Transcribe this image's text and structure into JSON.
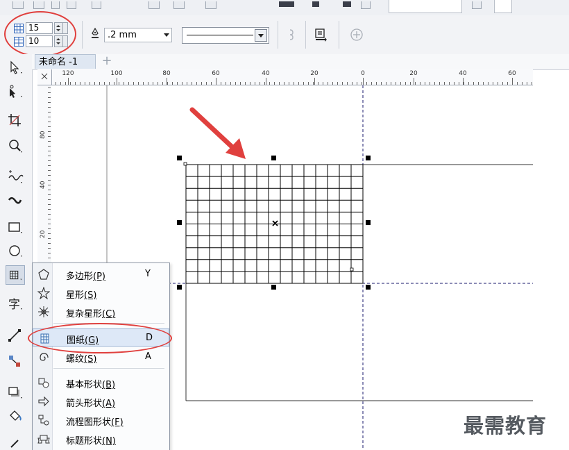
{
  "property_bar": {
    "grid_columns": "15",
    "grid_rows": "10",
    "outline_width": ".2 mm",
    "line_style": "solid"
  },
  "document": {
    "tab_title": "未命名 -1"
  },
  "ruler": {
    "h_labels": [
      "120",
      "100",
      "80",
      "60",
      "40",
      "20",
      "0",
      "20",
      "40",
      "60"
    ],
    "v_labels": [
      "80",
      "40",
      "20"
    ],
    "corner_icon": "ruler-origin-icon"
  },
  "flyout_menu": {
    "items": [
      {
        "icon": "polygon-icon",
        "label": "多边形",
        "mnemonic": "(P)",
        "shortcut": "Y"
      },
      {
        "icon": "star-icon",
        "label": "星形",
        "mnemonic": "(S)",
        "shortcut": ""
      },
      {
        "icon": "complex-star-icon",
        "label": "复杂星形",
        "mnemonic": "(C)",
        "shortcut": ""
      },
      {
        "icon": "graph-paper-icon",
        "label": "图纸",
        "mnemonic": "(G)",
        "shortcut": "D",
        "highlighted": true
      },
      {
        "icon": "spiral-icon",
        "label": "螺纹",
        "mnemonic": "(S)",
        "shortcut": "A"
      },
      {
        "icon": "basic-shapes-icon",
        "label": "基本形状",
        "mnemonic": "(B)",
        "shortcut": ""
      },
      {
        "icon": "arrow-shapes-icon",
        "label": "箭头形状",
        "mnemonic": "(A)",
        "shortcut": ""
      },
      {
        "icon": "flowchart-shapes-icon",
        "label": "流程图形状",
        "mnemonic": "(F)",
        "shortcut": ""
      },
      {
        "icon": "banner-shapes-icon",
        "label": "标题形状",
        "mnemonic": "(N)",
        "shortcut": ""
      }
    ]
  },
  "canvas": {
    "graph_paper": {
      "columns": 15,
      "rows": 10
    }
  },
  "watermark": "最需教育",
  "colors": {
    "annotation": "#e0403e",
    "guide": "#1a1a6e",
    "menu_highlight": "#dde8f7"
  }
}
